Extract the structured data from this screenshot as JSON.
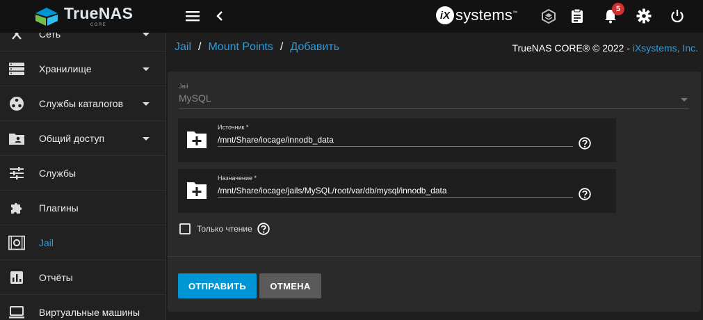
{
  "app": {
    "logo_name": "TrueNAS",
    "logo_sub": "CORE",
    "vendor_logo_mark": "iX",
    "vendor_logo_text": "systems",
    "vendor_logo_trademark": "™",
    "notifications_count": "5"
  },
  "sidebar": {
    "items": [
      {
        "label": "Сеть",
        "icon": "network-icon",
        "expandable": true
      },
      {
        "label": "Хранилище",
        "icon": "storage-icon",
        "expandable": true
      },
      {
        "label": "Службы каталогов",
        "icon": "directory-services-icon",
        "expandable": true
      },
      {
        "label": "Общий доступ",
        "icon": "sharing-icon",
        "expandable": true
      },
      {
        "label": "Службы",
        "icon": "services-icon",
        "expandable": false
      },
      {
        "label": "Плагины",
        "icon": "plugins-icon",
        "expandable": false
      },
      {
        "label": "Jail",
        "icon": "jail-icon",
        "expandable": false,
        "active": true
      },
      {
        "label": "Отчёты",
        "icon": "reports-icon",
        "expandable": false
      },
      {
        "label": "Виртуальные машины",
        "icon": "vm-icon",
        "expandable": false
      }
    ]
  },
  "breadcrumb": {
    "items": [
      "Jail",
      "Mount Points",
      "Добавить"
    ],
    "separator": "/"
  },
  "copyright": {
    "text": "TrueNAS CORE® © 2022 - ",
    "link": "iXsystems, Inc."
  },
  "form": {
    "jail_label": "Jail",
    "jail_value": "MySQL",
    "source_label": "Источник *",
    "source_value": "/mnt/Share/iocage/innodb_data",
    "destination_label": "Назначение *",
    "destination_value": "/mnt/Share/iocage/jails/MySQL/root/var/db/mysql/innodb_data",
    "readonly_label": "Только чтение",
    "readonly_checked": false,
    "submit_label": "ОТПРАВИТЬ",
    "cancel_label": "ОТМЕНА"
  },
  "colors": {
    "accent": "#2f9bdb",
    "submit": "#0095d5",
    "badge": "#d32f2f"
  }
}
